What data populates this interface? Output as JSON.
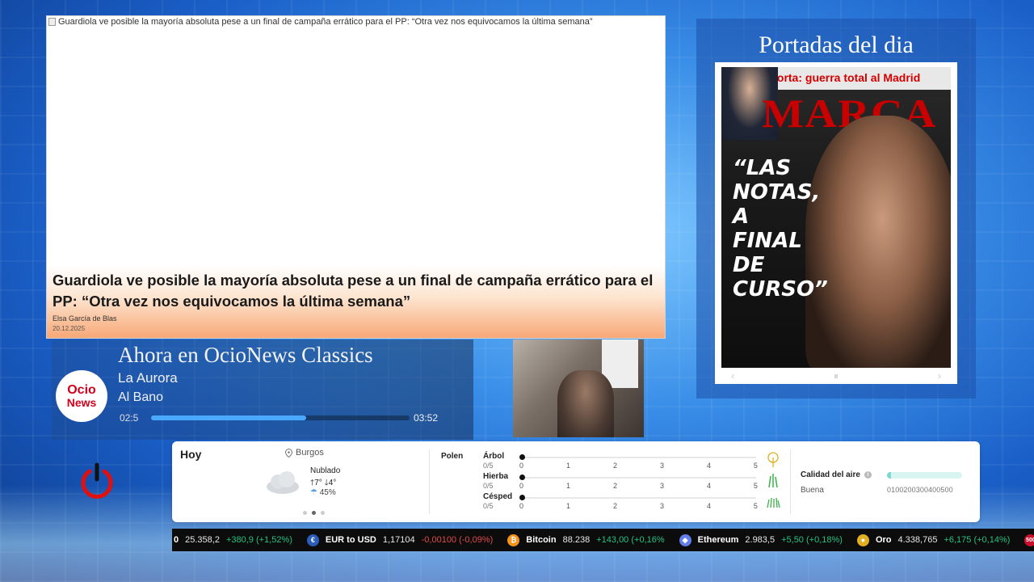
{
  "news": {
    "broken_image_alt": "Guardiola ve posible la mayoría absoluta pese a un final de campaña errático para el PP: “Otra vez nos equivocamos la última semana”",
    "headline": "Guardiola ve posible la mayoría absoluta pese a un final de campaña errático para el PP: “Otra vez nos equivocamos la última semana”",
    "author": "Elsa García de Blas",
    "date": "20.12.2025"
  },
  "portadas": {
    "title": "Portadas del dia",
    "cover_headline_top": "Laporta: guerra total al Madrid",
    "cover_logo": "MARCA",
    "cover_main": "“LAS\nNOTAS,\nA FINAL\nDE\nCURSO”"
  },
  "now_playing": {
    "title": "Ahora en OcioNews Classics",
    "song": "La Aurora",
    "artist": "Al Bano",
    "elapsed": "02:5",
    "total": "03:52",
    "progress": 0.6,
    "logo_top": "Ocio",
    "logo_bottom": "News"
  },
  "weather": {
    "day": "Hoy",
    "location": "Burgos",
    "condition": "Nublado",
    "temp_max": "7°",
    "temp_min": "4°",
    "rain": "45%",
    "polen_label": "Polen",
    "polen": [
      {
        "name": "Árbol",
        "value": "0/5"
      },
      {
        "name": "Hierba",
        "value": "0/5"
      },
      {
        "name": "Césped",
        "value": "0/5"
      }
    ],
    "polen_scale": [
      "0",
      "1",
      "2",
      "3",
      "4",
      "5"
    ],
    "air_quality_label": "Calidad del aire",
    "air_quality_status": "Buena",
    "air_quality_scale": "0100200300400500",
    "air_quality_level": 0.05
  },
  "ticker": [
    {
      "name": "",
      "value": "25.358,2",
      "change": "+380,9 (+1,52%)",
      "dir": "up",
      "prefix": "0"
    },
    {
      "name": "EUR to USD",
      "value": "1,17104",
      "change": "-0,00100 (-0,09%)",
      "dir": "down"
    },
    {
      "name": "Bitcoin",
      "value": "88.238",
      "change": "+143,00 (+0,16%",
      "dir": "up"
    },
    {
      "name": "Ethereum",
      "value": "2.983,5",
      "change": "+5,50 (+0,18%)",
      "dir": "up"
    },
    {
      "name": "Oro",
      "value": "4.338,765",
      "change": "+6,175 (+0,14%)",
      "dir": "up"
    },
    {
      "name": "S&",
      "value": "",
      "change": "",
      "dir": "up",
      "badge": "500"
    }
  ],
  "colors": {
    "accent_red": "#d0021b",
    "up": "#26c281",
    "down": "#e24a4a"
  }
}
